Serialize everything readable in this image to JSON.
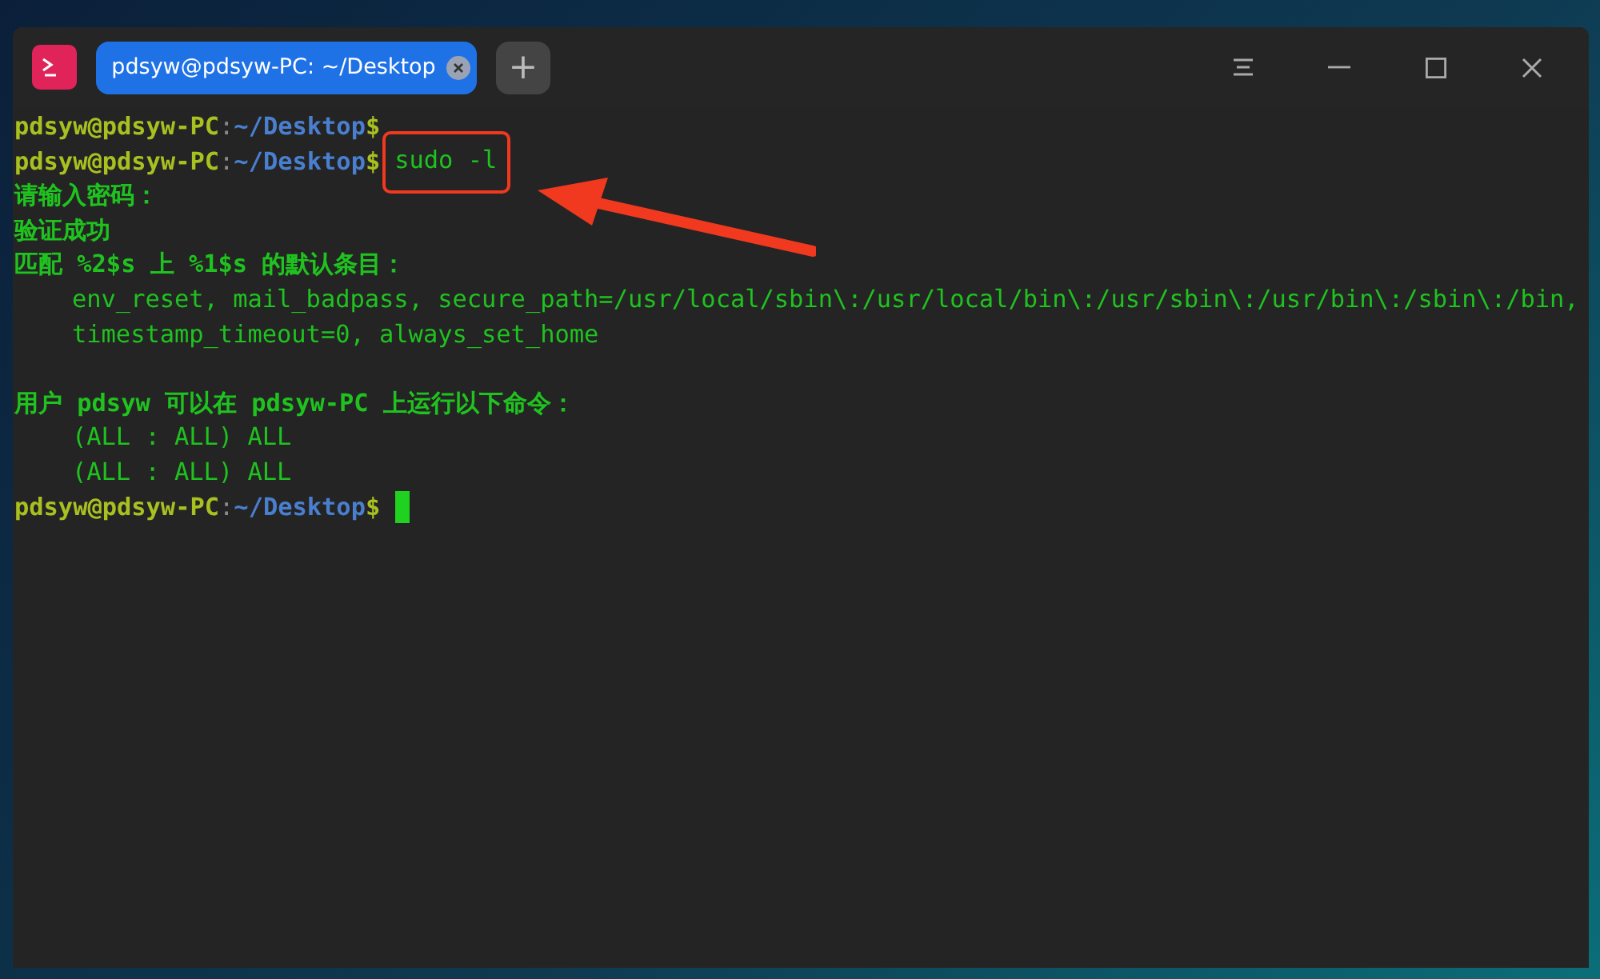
{
  "tabs": [
    {
      "label": "pdsyw@pdsyw-PC: ~/Desktop",
      "selected": true
    }
  ],
  "new_tab_button": "+",
  "terminal": {
    "lines": [
      {
        "kind": "prompt",
        "user": "pdsyw@pdsyw-PC",
        "separator": ":",
        "path": "~/Desktop",
        "symbol": "$"
      },
      {
        "kind": "prompt",
        "user": "pdsyw@pdsyw-PC",
        "separator": ":",
        "path": "~/Desktop",
        "symbol": "$",
        "command": "sudo -l",
        "highlighted": true
      },
      {
        "kind": "output",
        "text": "请输入密码：",
        "indent": false
      },
      {
        "kind": "output",
        "text": "验证成功",
        "indent": false
      },
      {
        "kind": "output",
        "text": "匹配 %2$s 上 %1$s 的默认条目：",
        "indent": false
      },
      {
        "kind": "output",
        "text": "env_reset, mail_badpass, secure_path=/usr/local/sbin\\:/usr/local/bin\\:/usr/sbin\\:/usr/bin\\:/sbin\\:/bin,",
        "indent": true
      },
      {
        "kind": "output",
        "text": "timestamp_timeout=0, always_set_home",
        "indent": true
      },
      {
        "kind": "blank"
      },
      {
        "kind": "output",
        "text": "用户 pdsyw 可以在 pdsyw-PC 上运行以下命令：",
        "indent": false
      },
      {
        "kind": "output",
        "text": "(ALL : ALL) ALL",
        "indent": true
      },
      {
        "kind": "output",
        "text": "(ALL : ALL) ALL",
        "indent": true
      },
      {
        "kind": "prompt",
        "user": "pdsyw@pdsyw-PC",
        "separator": ":",
        "path": "~/Desktop",
        "symbol": "$",
        "cursor": true
      }
    ]
  }
}
